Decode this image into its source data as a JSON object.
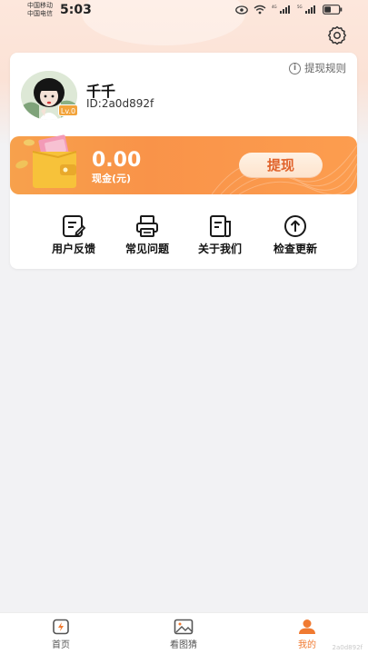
{
  "status_bar": {
    "carrier_1": "中国移动",
    "carrier_2": "中国电信",
    "time": "5:03",
    "battery_level": 0.45,
    "signal_tags": [
      "4G",
      "5G"
    ],
    "icons": [
      "eye-icon",
      "wifi-icon",
      "signal-icon",
      "signal-icon",
      "battery-icon"
    ]
  },
  "header": {
    "settings_icon": "gear-icon"
  },
  "profile": {
    "rules_label": "提现规则",
    "rules_icon": "info-icon",
    "nickname": "千千",
    "user_id": "ID:2a0d892f",
    "level": "Lv.0"
  },
  "cash": {
    "amount": "0.00",
    "label": "现金(元)",
    "withdraw_label": "提现",
    "wallet_icon": "wallet-icon"
  },
  "actions": [
    {
      "label": "用户反馈",
      "icon": "feedback-icon"
    },
    {
      "label": "常见问题",
      "icon": "printer-icon"
    },
    {
      "label": "关于我们",
      "icon": "document-icon"
    },
    {
      "label": "检查更新",
      "icon": "arrow-up-circle-icon"
    }
  ],
  "bottom_nav": [
    {
      "label": "首页",
      "icon": "home-icon",
      "active": false
    },
    {
      "label": "看图猜",
      "icon": "picture-icon",
      "active": false
    },
    {
      "label": "我的",
      "icon": "user-icon",
      "active": true
    }
  ],
  "watermark": "2a0d892f",
  "colors": {
    "accent": "#f07a31",
    "cash_gradient_start": "#f7a14c",
    "cash_gradient_end": "#fc9d4f",
    "page_bg": "#f2f2f4"
  }
}
